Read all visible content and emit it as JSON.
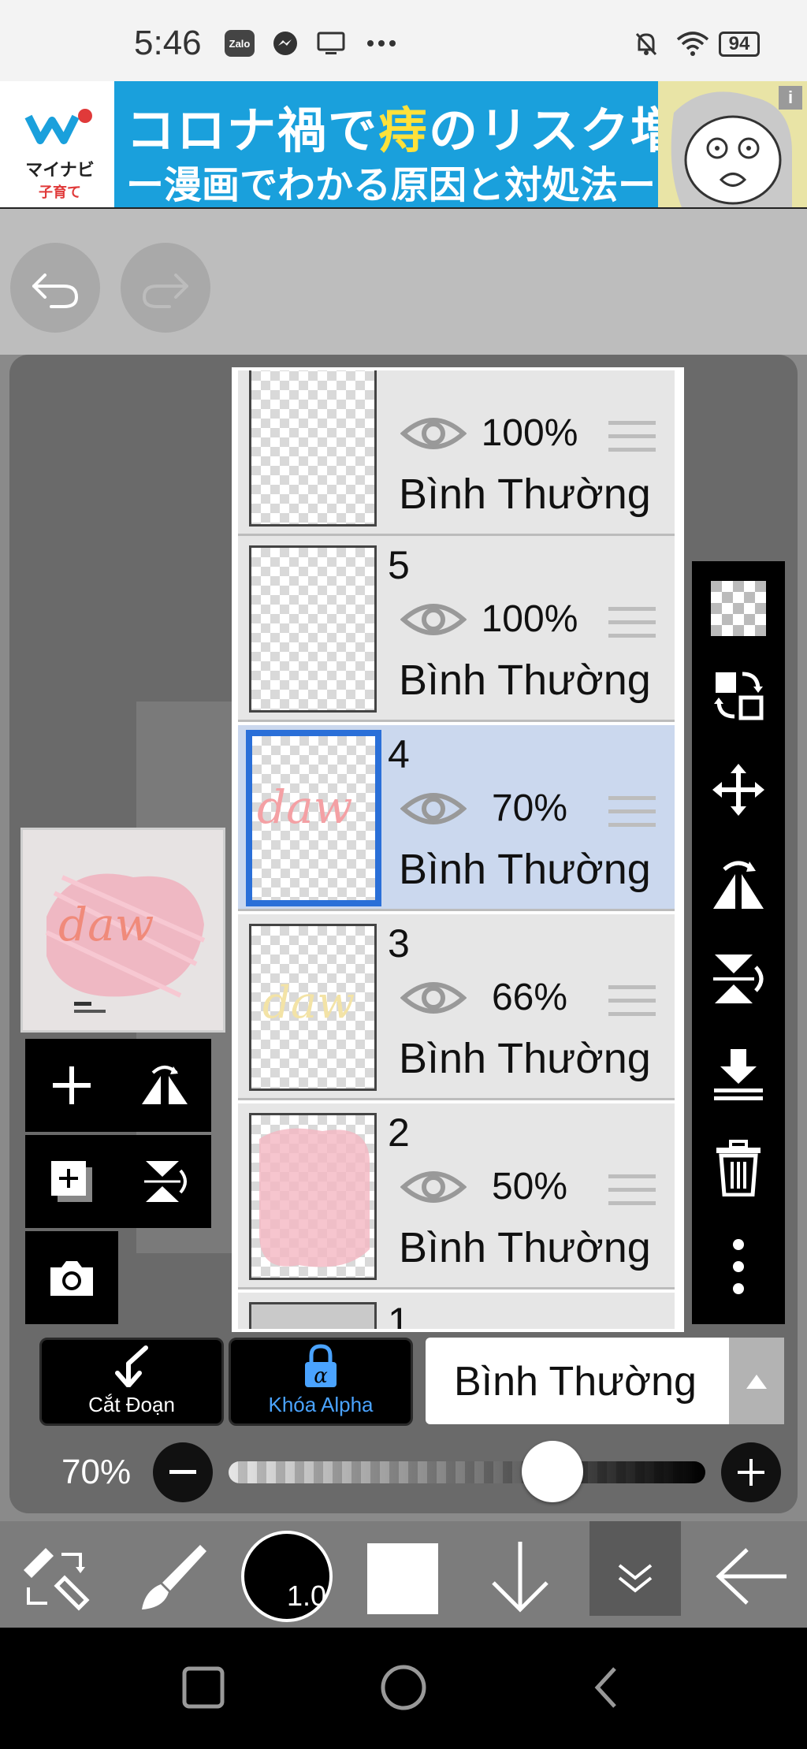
{
  "status_bar": {
    "time": "5:46",
    "apps": [
      "Zalo",
      "messenger-icon",
      "tv-icon",
      "more-icon"
    ],
    "battery": "94"
  },
  "ad": {
    "brand_line1": "マイナビ",
    "brand_line2": "子育て",
    "headline_a": "コロナ禍で",
    "headline_hl": "痔",
    "headline_b": "のリスク増？",
    "subline": "ー漫画でわかる原因と対処法ー",
    "info": "i"
  },
  "layers": [
    {
      "num": "",
      "opacity": "100%",
      "blend": "Bình Thường"
    },
    {
      "num": "5",
      "opacity": "100%",
      "blend": "Bình Thường"
    },
    {
      "num": "4",
      "opacity": "70%",
      "blend": "Bình Thường",
      "selected": true
    },
    {
      "num": "3",
      "opacity": "66%",
      "blend": "Bình Thường"
    },
    {
      "num": "2",
      "opacity": "50%",
      "blend": "Bình Thường"
    },
    {
      "num": "1"
    }
  ],
  "bottom": {
    "cut_label": "Cắt Đoạn",
    "alpha_label": "Khóa Alpha",
    "blend_mode": "Bình Thường",
    "opacity_value": "70%",
    "opacity_fraction": 0.7,
    "brush_size": "1.0"
  },
  "colors": {
    "selected_layer": "#cbd8ee",
    "selected_border": "#2a6fd8",
    "alpha_blue": "#4aa3ff"
  }
}
